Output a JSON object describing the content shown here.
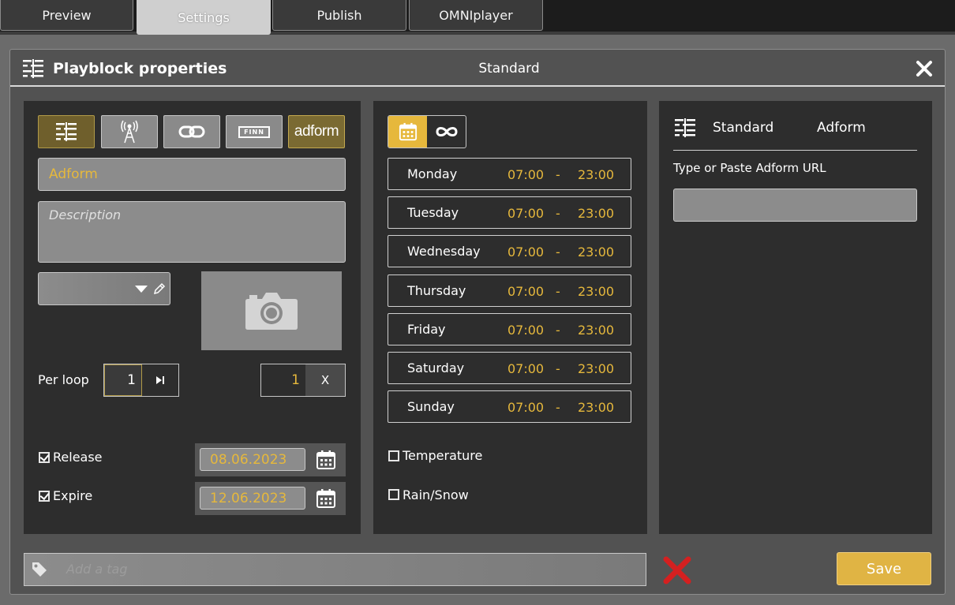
{
  "tabs": [
    {
      "label": "Preview"
    },
    {
      "label": "Settings"
    },
    {
      "label": "Publish"
    },
    {
      "label": "OMNIplayer"
    }
  ],
  "modal": {
    "title": "Playblock properties",
    "center_title": "Standard"
  },
  "left": {
    "types": [
      "list-icon",
      "broadcast-icon",
      "link-icon",
      "finn-icon",
      "adform-icon"
    ],
    "finn_label": "FINN",
    "adform_label": "adform",
    "name_value": "Adform",
    "description_placeholder": "Description",
    "per_loop_label": "Per loop",
    "per_loop_value": "1",
    "repeat_value": "1",
    "repeat_btn": "X",
    "release_label": "Release",
    "release_checked": true,
    "release_date": "08.06.2023",
    "expire_label": "Expire",
    "expire_checked": true,
    "expire_date": "12.06.2023"
  },
  "schedule": {
    "days": [
      {
        "name": "Monday",
        "from": "07:00",
        "to": "23:00"
      },
      {
        "name": "Tuesday",
        "from": "07:00",
        "to": "23:00"
      },
      {
        "name": "Wednesday",
        "from": "07:00",
        "to": "23:00"
      },
      {
        "name": "Thursday",
        "from": "07:00",
        "to": "23:00"
      },
      {
        "name": "Friday",
        "from": "07:00",
        "to": "23:00"
      },
      {
        "name": "Saturday",
        "from": "07:00",
        "to": "23:00"
      },
      {
        "name": "Sunday",
        "from": "07:00",
        "to": "23:00"
      }
    ],
    "dash": "-",
    "temperature_label": "Temperature",
    "rain_label": "Rain/Snow"
  },
  "right": {
    "tab_standard": "Standard",
    "tab_adform": "Adform",
    "url_label": "Type or Paste Adform URL",
    "url_value": ""
  },
  "footer": {
    "tag_placeholder": "Add a tag",
    "save_label": "Save"
  },
  "colors": {
    "accent": "#e6b83c",
    "delete": "#d42020"
  }
}
